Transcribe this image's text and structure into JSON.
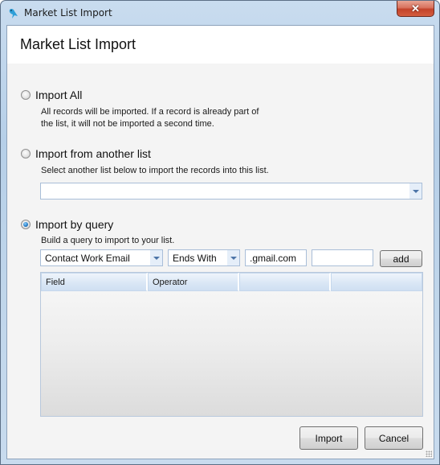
{
  "window": {
    "title": "Market List Import",
    "close_label": "✕"
  },
  "header": {
    "title": "Market List Import"
  },
  "options": {
    "import_all": {
      "label": "Import All",
      "selected": false,
      "description_line1": "All records will be imported.  If a record is already part of",
      "description_line2": "the list, it will not be imported a second time."
    },
    "import_from_list": {
      "label": "Import from another list",
      "selected": false,
      "description": "Select another list below to import the records into this list.",
      "list_value": ""
    },
    "import_by_query": {
      "label": "Import by query",
      "selected": true,
      "description": "Build a query to import to your list."
    }
  },
  "query": {
    "field_value": "Contact Work Email",
    "operator_value": "Ends With",
    "value1": ".gmail.com",
    "value2": "",
    "add_label": "add"
  },
  "grid": {
    "columns": [
      "Field",
      "Operator",
      "",
      ""
    ],
    "rows": []
  },
  "footer": {
    "import_label": "Import",
    "cancel_label": "Cancel"
  }
}
